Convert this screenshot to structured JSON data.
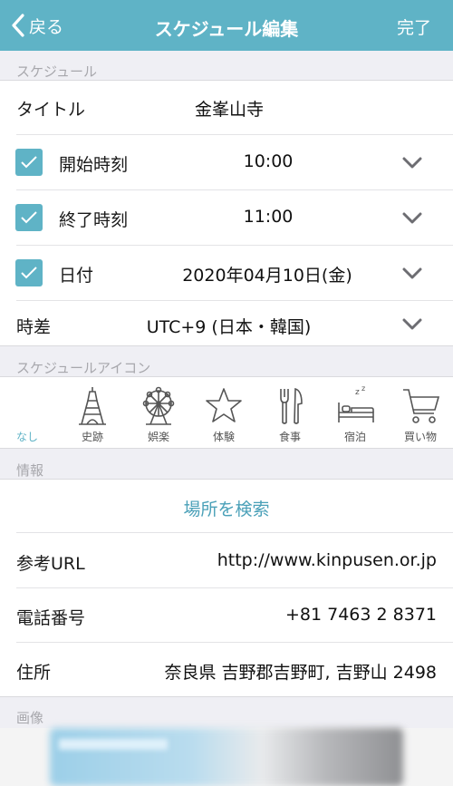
{
  "nav": {
    "back_label": "戻る",
    "title": "スケジュール編集",
    "done_label": "完了"
  },
  "sections": {
    "schedule": "スケジュール",
    "schedule_icon": "スケジュールアイコン",
    "info": "情報",
    "image": "画像"
  },
  "schedule": {
    "title_label": "タイトル",
    "title_value": "金峯山寺",
    "start_label": "開始時刻",
    "start_value": "10:00",
    "start_checked": true,
    "end_label": "終了時刻",
    "end_value": "11:00",
    "end_checked": true,
    "date_label": "日付",
    "date_value": "2020年04月10日(金)",
    "date_checked": true,
    "tz_label": "時差",
    "tz_value": "UTC+9 (日本・韓国)"
  },
  "icons": {
    "none_label": "なし",
    "items": [
      {
        "label": "史跡",
        "icon": "eiffel-tower-icon"
      },
      {
        "label": "娯楽",
        "icon": "ferris-wheel-icon"
      },
      {
        "label": "体験",
        "icon": "star-icon"
      },
      {
        "label": "食事",
        "icon": "fork-knife-icon"
      },
      {
        "label": "宿泊",
        "icon": "bed-icon"
      },
      {
        "label": "買い物",
        "icon": "shopping-cart-icon"
      }
    ]
  },
  "info": {
    "search_label": "場所を検索",
    "url_label": "参考URL",
    "url_value": "http://www.kinpusen.or.jp",
    "phone_label": "電話番号",
    "phone_value": "+81 7463 2 8371",
    "address_label": "住所",
    "address_value": "奈良県 吉野郡吉野町, 吉野山 2498"
  },
  "colors": {
    "accent": "#5fb3c6",
    "link": "#4aa0b8",
    "background": "#efeff4"
  }
}
